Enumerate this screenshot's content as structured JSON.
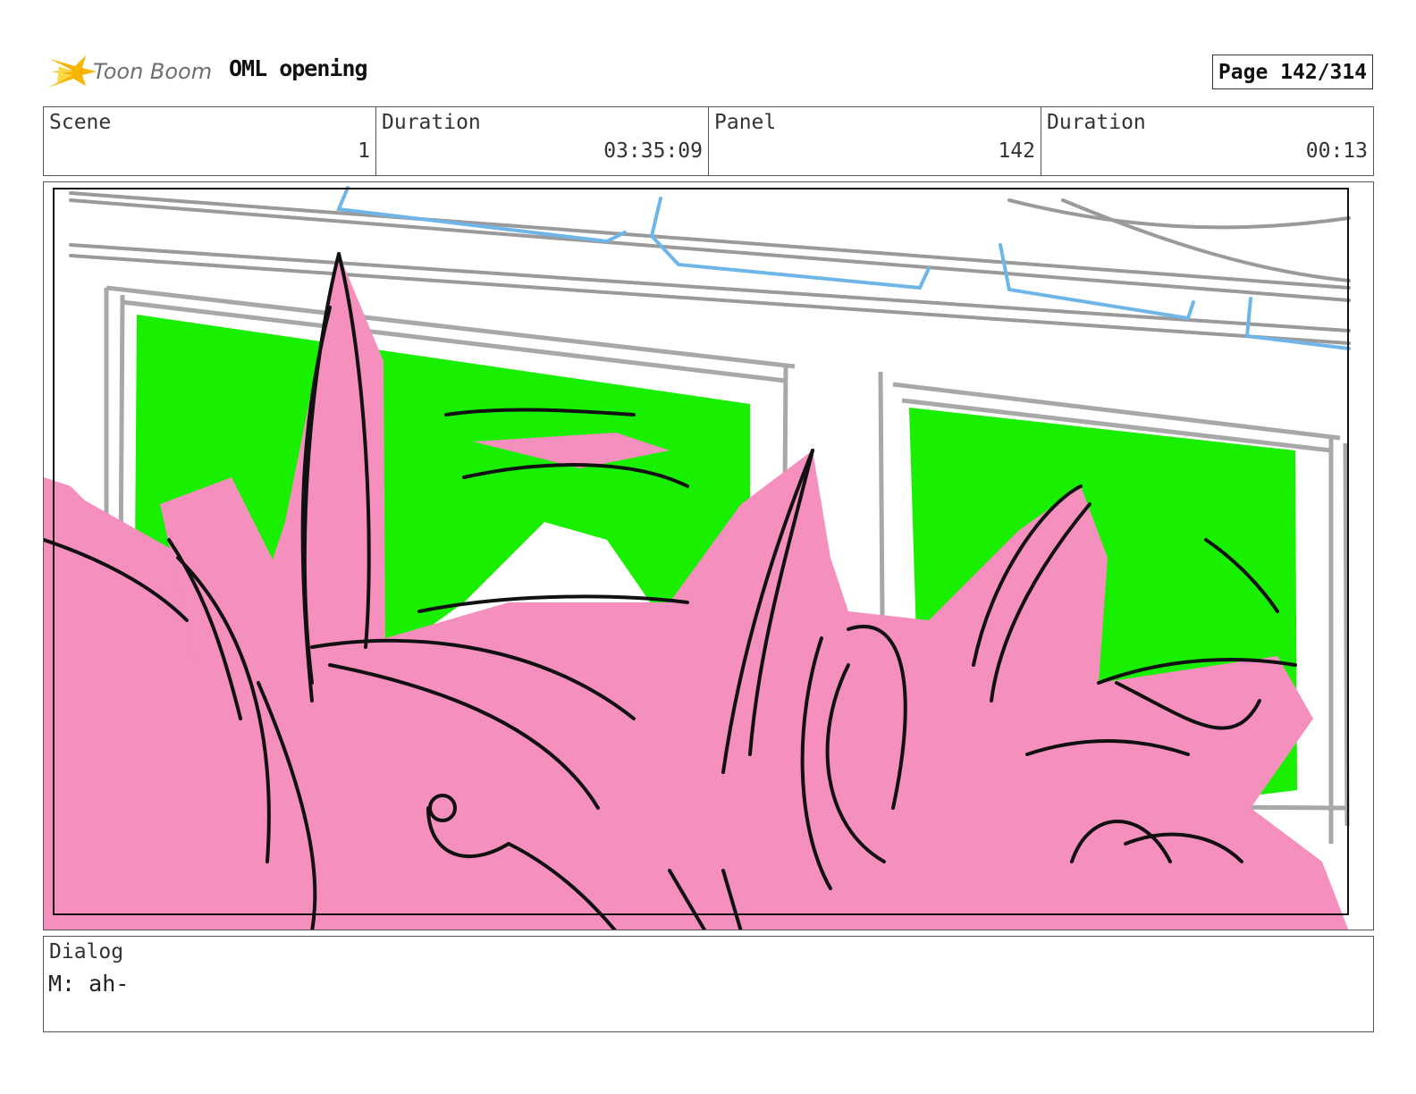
{
  "header": {
    "brand_text": "Toon Boom",
    "project_title": "OML opening",
    "page_label": "Page 142/314"
  },
  "info": {
    "scene_label": "Scene",
    "scene_value": "1",
    "scene_duration_label": "Duration",
    "scene_duration_value": "03:35:09",
    "panel_label": "Panel",
    "panel_value": "142",
    "panel_duration_label": "Duration",
    "panel_duration_value": "00:13"
  },
  "dialog": {
    "label": "Dialog",
    "text": "M: ah-"
  },
  "colors": {
    "sketch_pink": "#f48fbe",
    "screen_green": "#19f000",
    "ink": "#111111",
    "frame_gray": "#9a9a9a",
    "sky_blue": "#6fb6e8",
    "logo_yellow": "#f7b500"
  }
}
